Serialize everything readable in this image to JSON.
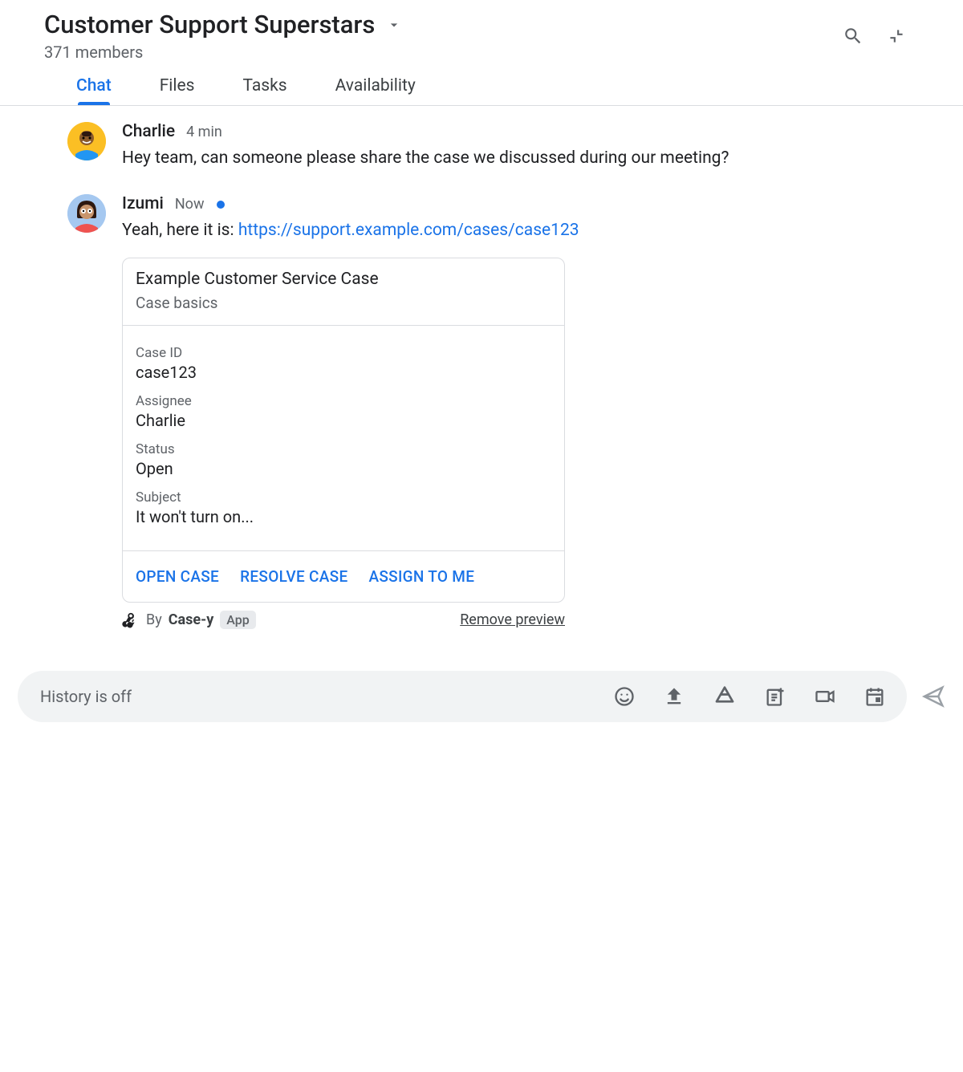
{
  "header": {
    "title": "Customer Support Superstars",
    "members": "371 members"
  },
  "tabs": [
    {
      "label": "Chat",
      "active": true
    },
    {
      "label": "Files",
      "active": false
    },
    {
      "label": "Tasks",
      "active": false
    },
    {
      "label": "Availability",
      "active": false
    }
  ],
  "messages": [
    {
      "author": "Charlie",
      "time": "4 min",
      "text": "Hey team, can someone please share the case we discussed during our meeting?"
    },
    {
      "author": "Izumi",
      "time": "Now",
      "text_prefix": "Yeah, here it is: ",
      "link": "https://support.example.com/cases/case123"
    }
  ],
  "card": {
    "title": "Example Customer Service Case",
    "subtitle": "Case basics",
    "fields": [
      {
        "label": "Case ID",
        "value": "case123"
      },
      {
        "label": "Assignee",
        "value": "Charlie"
      },
      {
        "label": "Status",
        "value": "Open"
      },
      {
        "label": "Subject",
        "value": "It won't turn on..."
      }
    ],
    "actions": [
      "OPEN CASE",
      "RESOLVE CASE",
      "ASSIGN TO ME"
    ],
    "attribution_by": "By",
    "attribution_app": "Case-y",
    "app_badge": "App",
    "remove_preview": "Remove preview"
  },
  "composer": {
    "placeholder": "History is off"
  }
}
